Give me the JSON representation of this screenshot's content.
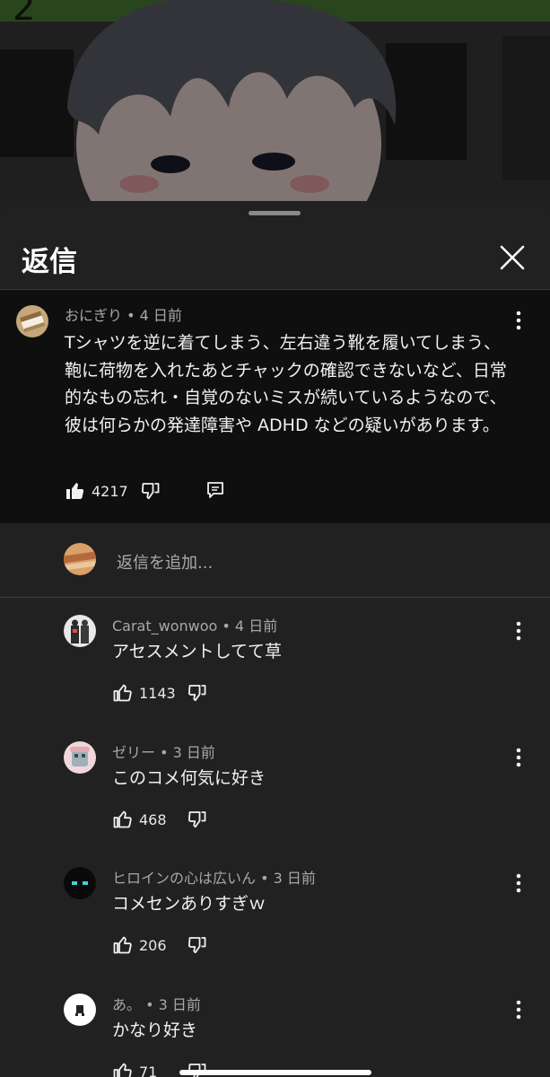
{
  "sheet": {
    "title": "返信"
  },
  "parent_comment": {
    "author": "おにぎり",
    "age": "4 日前",
    "meta": "おにぎり • 4 日前",
    "body": "Tシャツを逆に着てしまう、左右違う靴を履いてしまう、鞄に荷物を入れたあとチャックの確認できないなど、日常的なもの忘れ・自覚のないミスが続いているようなので、彼は何らかの発達障害や ADHD などの疑いがあります。",
    "likes": "4217"
  },
  "add_reply": {
    "placeholder": "返信を追加..."
  },
  "replies": [
    {
      "author": "Carat_wonwoo",
      "meta": "Carat_wonwoo • 4 日前",
      "text": "アセスメントしてて草",
      "likes": "1143"
    },
    {
      "author": "ゼリー",
      "meta": "ゼリー • 3 日前",
      "text": "このコメ何気に好き",
      "likes": "468"
    },
    {
      "author": "ヒロインの心は広いん",
      "meta": "ヒロインの心は広いん • 3 日前",
      "text": "コメセンありすぎｗ",
      "likes": "206"
    },
    {
      "author": "あ。",
      "meta": "あ。 • 3 日前",
      "text": "かなり好き",
      "likes": "71"
    }
  ],
  "colors": {
    "sheet_bg": "#212121",
    "parent_bg": "#0f0f0f",
    "meta_text": "#a8a8a8"
  },
  "icons": [
    "close-icon",
    "more-vert-icon",
    "thumb-up-filled-icon",
    "thumb-up-icon",
    "thumb-down-icon",
    "reply-icon"
  ]
}
